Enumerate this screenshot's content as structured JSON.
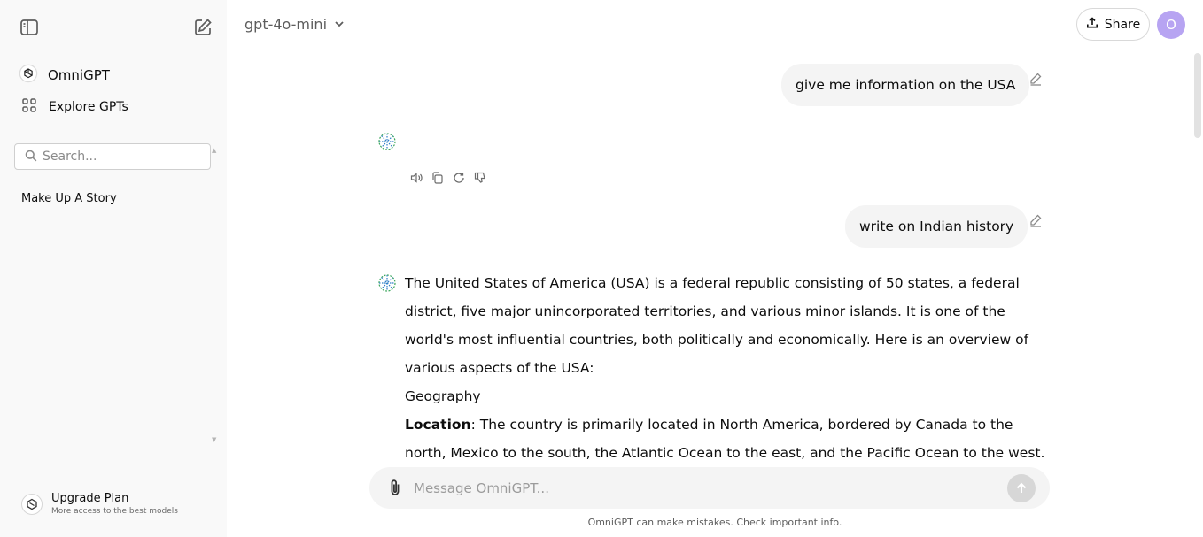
{
  "sidebar": {
    "brand": "OmniGPT",
    "explore": "Explore GPTs",
    "search_placeholder": "Search...",
    "history": [
      "Make Up A Story"
    ],
    "upgrade": {
      "title": "Upgrade Plan",
      "subtitle": "More access to the best models"
    }
  },
  "header": {
    "model": "gpt-4o-mini",
    "share_label": "Share",
    "avatar_initial": "O"
  },
  "conversation": {
    "user_message_1": "give me information on the USA",
    "user_message_2": "write on Indian history",
    "answer": {
      "intro": "The United States of America (USA) is a federal republic consisting of 50 states, a federal district, five major unincorporated territories, and various minor islands. It is one of the world's most influential countries, both politically and economically. Here is an overview of various aspects of the USA:",
      "section_heading": "Geography",
      "location_label": "Location",
      "location_text": ": The country is primarily located in North America, bordered by Canada to the north, Mexico to the south, the Atlantic Ocean to the east, and the Pacific Ocean to the west. The state"
    }
  },
  "composer": {
    "placeholder": "Message OmniGPT...",
    "disclaimer": "OmniGPT can make mistakes. Check important info."
  },
  "colors": {
    "sidebar_bg": "#f9f9f9",
    "bubble_bg": "#f4f4f4",
    "avatar_bg": "#b7a4f2",
    "text": "#0d0d0d",
    "bot_icon_green": "#3aa65a",
    "bot_icon_blue": "#2f7fc8"
  },
  "icons": [
    "sidebar-toggle-icon",
    "new-chat-icon",
    "openai-logo-icon",
    "grid-icon",
    "search-icon",
    "chevron-down-icon",
    "upload-icon",
    "edit-pencil-icon",
    "bot-logo-icon",
    "speaker-icon",
    "copy-icon",
    "regenerate-icon",
    "thumbs-down-icon",
    "paperclip-icon",
    "arrow-up-icon",
    "upgrade-icon"
  ]
}
